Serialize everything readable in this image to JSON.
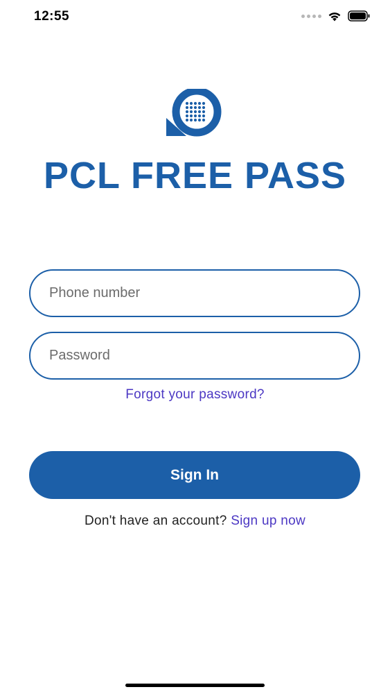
{
  "status_bar": {
    "time": "12:55",
    "signal_icon": "cellular-signal-dots",
    "wifi_icon": "wifi-icon",
    "battery_icon": "battery-icon"
  },
  "app": {
    "logo_icon": "chat-bubble-keypad-logo",
    "title": "PCL FREE PASS",
    "brand_color": "#1c5fa8",
    "link_color": "#4b37c3"
  },
  "form": {
    "phone_placeholder": "Phone number",
    "phone_value": "",
    "password_placeholder": "Password",
    "password_value": "",
    "forgot_password_label": "Forgot your password?",
    "sign_in_label": "Sign In",
    "no_account_text": "Don't have an account?",
    "sign_up_label": "Sign up now"
  }
}
